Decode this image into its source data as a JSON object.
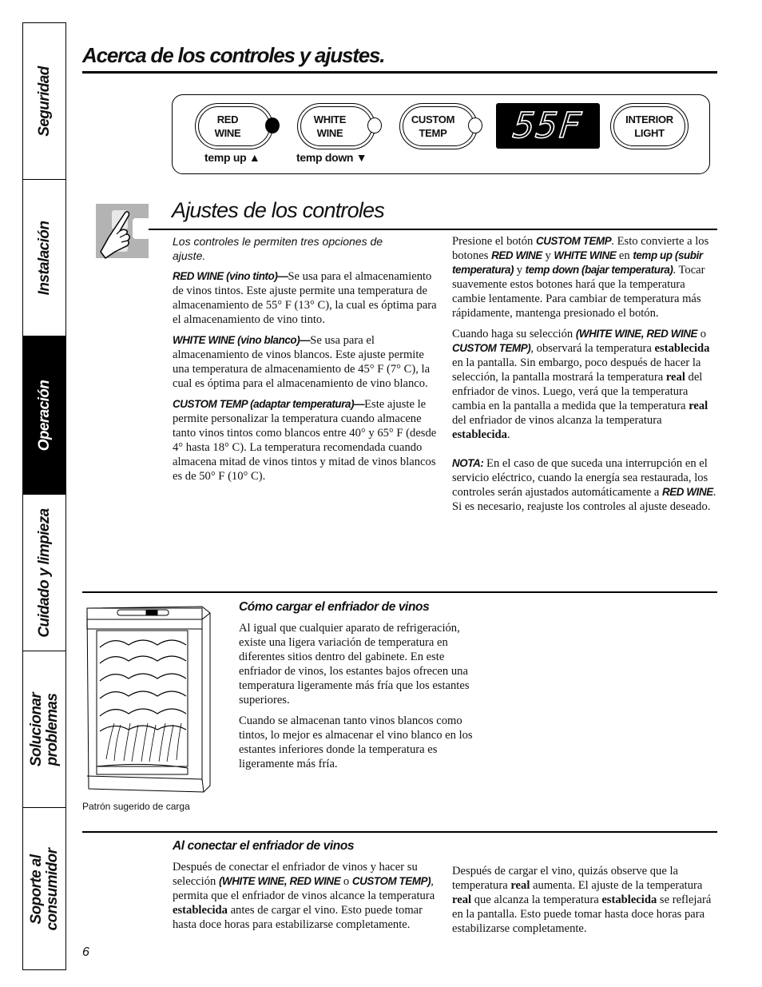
{
  "side_tabs": [
    {
      "lines": [
        "Seguridad"
      ],
      "active": false
    },
    {
      "lines": [
        "Instalación"
      ],
      "active": false
    },
    {
      "lines": [
        "Operación"
      ],
      "active": true
    },
    {
      "lines": [
        "Cuidado y limpieza"
      ],
      "active": false
    },
    {
      "lines": [
        "Solucionar",
        "problemas"
      ],
      "active": false
    },
    {
      "lines": [
        "Soporte al",
        "consumidor"
      ],
      "active": false
    }
  ],
  "page_title": "Acerca de los controles y ajustes.",
  "control_panel": {
    "buttons": [
      {
        "line1": "RED",
        "line2": "WINE",
        "indicator": "on",
        "sub_label": "temp up ▲"
      },
      {
        "line1": "WHITE",
        "line2": "WINE",
        "indicator": "off",
        "sub_label": "temp down ▼"
      },
      {
        "line1": "CUSTOM",
        "line2": "TEMP",
        "indicator": "off",
        "sub_label": ""
      },
      {
        "line1": "INTERIOR",
        "line2": "LIGHT",
        "indicator": "none",
        "sub_label": ""
      }
    ],
    "display_value": "55F"
  },
  "section": {
    "icon": "hand-pointer-icon",
    "title": "Ajustes de los controles",
    "intro": "Los controles le permiten tres opciones de ajuste.",
    "left_paragraphs": [
      {
        "term": "RED WINE (vino tinto)—",
        "text": "Se usa para el almacenamiento de vinos tintos. Este ajuste permite una temperatura de almacenamiento de 55° F (13° C), la cual es óptima para el almacenamiento de vino tinto."
      },
      {
        "term": "WHITE WINE (vino blanco)—",
        "text": "Se usa para el almacenamiento de vinos blancos. Este ajuste permite una temperatura de almacenamiento de 45° F (7° C), la cual es óptima para el almacenamiento de vino blanco."
      },
      {
        "term": "CUSTOM TEMP (adaptar temperatura)—",
        "text": "Este ajuste le permite personalizar la temperatura cuando almacene tanto vinos tintos como blancos entre 40° y 65° F (desde 4° hasta 18° C). La temperatura recomendada cuando almacena mitad de vinos tintos y mitad de vinos blancos es de 50° F (10° C)."
      }
    ],
    "right_p1": {
      "t1": "Presione el botón ",
      "b1": "CUSTOM TEMP",
      "t2": ". Esto convierte a los botones ",
      "b2": "RED WINE",
      "t3": " y ",
      "b3": "WHITE WINE",
      "t4": " en ",
      "b4": "temp up (subir temperatura)",
      "t5": " y ",
      "b5": "temp down (bajar temperatura)",
      "t6": ". Tocar suavemente estos botones hará que la temperatura cambie lentamente. Para cambiar de temperatura más rápidamente, mantenga presionado el botón."
    },
    "right_p2": {
      "t1": "Cuando haga su selección ",
      "b1": "(WHITE WINE, RED WINE",
      "t2": " o ",
      "b2": "CUSTOM TEMP)",
      "t3": ", observará la temperatura ",
      "s1": "establecida",
      "t4": " en la pantalla. Sin embargo, poco después de hacer la selección, la pantalla mostrará la temperatura ",
      "s2": "real",
      "t5": " del enfriador de vinos. Luego, verá que la temperatura cambia en la pantalla a medida que la temperatura ",
      "s3": "real",
      "t6": " del enfriador de vinos alcanza la temperatura ",
      "s4": "establecida",
      "t7": "."
    },
    "note": {
      "label": "NOTA:",
      "t1": " En el caso de que suceda una interrupción en el servicio eléctrico, cuando la energía sea restaurada, los controles serán ajustados automáticamente a ",
      "b1": "RED WINE",
      "t2": ". Si es necesario, reajuste los controles al ajuste deseado."
    }
  },
  "loading": {
    "title": "Cómo cargar el enfriador de vinos",
    "p1": "Al igual que cualquier aparato de refrigeración, existe una ligera variación de temperatura en diferentes sitios dentro del gabinete. En este enfriador de vinos, los estantes bajos ofrecen una temperatura ligeramente más fría que los estantes superiores.",
    "p2": "Cuando se almacenan tanto vinos blancos como tintos, lo mejor es almacenar el vino blanco en los estantes inferiores donde la temperatura es ligeramente más fría.",
    "image_caption": "Patrón sugerido de carga"
  },
  "connecting": {
    "title": "Al conectar el enfriador de vinos",
    "left": {
      "t1": "Después de conectar el enfriador de vinos y hacer su selección ",
      "b1": "(WHITE WINE, RED WINE",
      "t2": " o ",
      "b2": "CUSTOM TEMP)",
      "t3": ", permita que el enfriador de vinos alcance la temperatura ",
      "s1": "establecida",
      "t4": " antes de cargar el vino. Esto puede tomar hasta doce horas para estabilizarse completamente."
    },
    "right": {
      "t1": "Después de cargar el vino, quizás observe que la temperatura ",
      "s1": "real",
      "t2": " aumenta. El ajuste de la temperatura ",
      "s2": "real",
      "t3": " que alcanza la temperatura ",
      "s3": "establecida",
      "t4": " se reflejará en la pantalla. Esto puede tomar hasta doce horas para estabilizarse completamente."
    }
  },
  "page_number": "6"
}
